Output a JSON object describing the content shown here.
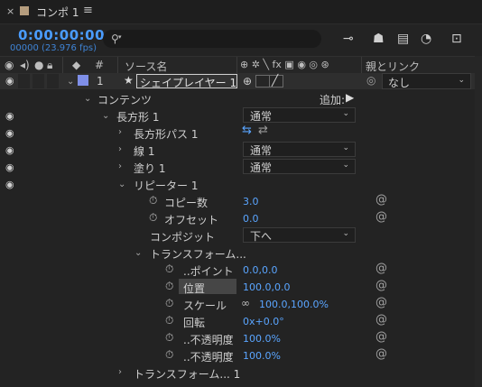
{
  "tab": {
    "title": "コンポ 1",
    "close_glyph": "×",
    "menu_glyph": "≡"
  },
  "timecode": "0:00:00:00",
  "fps": "00000 (23.976 fps)",
  "search": {
    "placeholder": ""
  },
  "header": {
    "num": "#",
    "source_name": "ソース名",
    "parent_link": "親とリンク"
  },
  "layer": {
    "number": "1",
    "name": "シェイプレイヤー 1",
    "parent": "なし",
    "label_color": "#7f8fe8"
  },
  "rows": {
    "contents": "コンテンツ",
    "add": "追加:",
    "rect": "長方形 1",
    "rect_mode": "通常",
    "rect_path": "長方形パス 1",
    "stroke": "線 1",
    "stroke_mode": "通常",
    "fill": "塗り 1",
    "fill_mode": "通常",
    "repeater": "リピーター 1",
    "copies_label": "コピー数",
    "copies_value": "3.0",
    "offset_label": "オフセット",
    "offset_value": "0.0",
    "composite_label": "コンポジット",
    "composite_value": "下へ",
    "transform_label": "トランスフォーム...",
    "anchor_label": "..ポイント",
    "anchor_value": "0.0,0.0",
    "position_label": "位置",
    "position_value": "100.0,0.0",
    "scale_label": "スケール",
    "scale_value": "100.0,100.0%",
    "rotation_label": "回転",
    "rotation_value": "0x+0.0°",
    "start_opacity_label": "..不透明度",
    "start_opacity_value": "100.0%",
    "end_opacity_label": "..不透明度",
    "end_opacity_value": "100.0%",
    "transform_1": "トランスフォーム... 1"
  },
  "colors": {
    "accent": "#4a9cff",
    "value_blue": "#5aa5ff"
  }
}
